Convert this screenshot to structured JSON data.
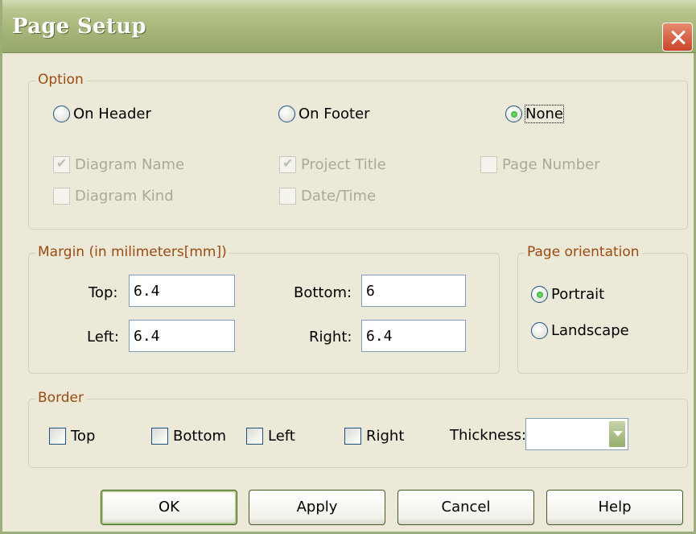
{
  "window": {
    "title": "Page Setup"
  },
  "option": {
    "legend": "Option",
    "radios": {
      "on_header": "On Header",
      "on_footer": "On Footer",
      "none": "None"
    },
    "checkboxes": {
      "diagram_name": "Diagram Name",
      "project_title": "Project Title",
      "page_number": "Page Number",
      "diagram_kind": "Diagram Kind",
      "date_time": "Date/Time"
    }
  },
  "margin": {
    "legend": "Margin (in milimeters[mm])",
    "top_label": "Top:",
    "top_value": "6.4",
    "bottom_label": "Bottom:",
    "bottom_value": "6",
    "left_label": "Left:",
    "left_value": "6.4",
    "right_label": "Right:",
    "right_value": "6.4"
  },
  "orientation": {
    "legend": "Page orientation",
    "portrait": "Portrait",
    "landscape": "Landscape",
    "selected": "Portrait"
  },
  "border": {
    "legend": "Border",
    "top": "Top",
    "bottom": "Bottom",
    "left": "Left",
    "right": "Right",
    "thickness_label": "Thickness:",
    "thickness_value": ""
  },
  "buttons": {
    "ok": "OK",
    "apply": "Apply",
    "cancel": "Cancel",
    "help": "Help"
  },
  "colors": {
    "title_bar": "#A7B67A",
    "legend_text": "#9C4A10",
    "close_button": "#C9452A",
    "background": "#ECE9D8"
  }
}
